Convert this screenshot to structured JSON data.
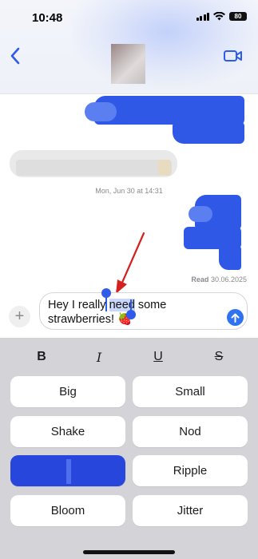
{
  "status_bar": {
    "time": "10:48",
    "battery": "80"
  },
  "header": {
    "back_icon": "chevron-left-icon",
    "video_icon": "video-camera-icon"
  },
  "chat": {
    "timestamp_day": "Mon, Jun 30",
    "timestamp_time": "at 14:31",
    "read_label": "Read",
    "read_date": "30.06.2025"
  },
  "composer": {
    "text_before": "Hey I really ",
    "text_selected": "need",
    "text_after": " some strawberries! ",
    "emoji": "🍓",
    "plus_label": "+"
  },
  "format_bar": {
    "bold": "B",
    "italic": "I",
    "underline": "U",
    "strike": "S"
  },
  "effects": [
    {
      "label": "Big"
    },
    {
      "label": "Small"
    },
    {
      "label": "Shake"
    },
    {
      "label": "Nod"
    },
    {
      "label": ""
    },
    {
      "label": "Ripple"
    },
    {
      "label": "Bloom"
    },
    {
      "label": "Jitter"
    }
  ],
  "colors": {
    "accent": "#2f73f1",
    "bubble_blue": "#2f58e6",
    "panel_bg": "#d4d4d8"
  }
}
